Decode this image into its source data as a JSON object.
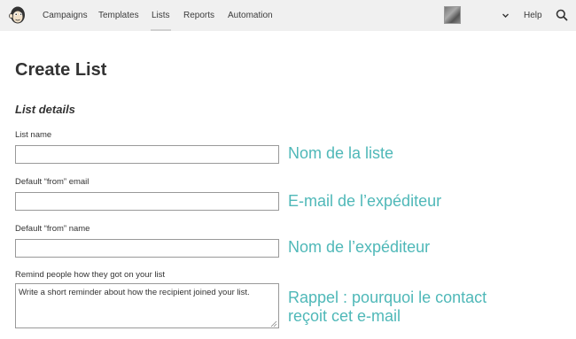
{
  "nav": {
    "items": [
      {
        "label": "Campaigns"
      },
      {
        "label": "Templates"
      },
      {
        "label": "Lists"
      },
      {
        "label": "Reports"
      },
      {
        "label": "Automation"
      }
    ],
    "help_label": "Help",
    "logo_icon": "chimp-logo-icon",
    "search_icon": "search-icon"
  },
  "page": {
    "title": "Create List",
    "section_title": "List details"
  },
  "fields": {
    "list_name": {
      "label": "List name",
      "value": ""
    },
    "from_email": {
      "label": "Default “from” email",
      "value": ""
    },
    "from_name": {
      "label": "Default “from” name",
      "value": ""
    },
    "reminder": {
      "label": "Remind people how they got on your list",
      "placeholder": "Write a short reminder about how the recipient joined your list."
    }
  },
  "annotations": {
    "list_name": "Nom de la liste",
    "from_email": "E-mail de l’expéditeur",
    "from_name": "Nom de l’expéditeur",
    "reminder_line1": "Rappel : pourquoi le contact",
    "reminder_line2": "reçoit cet e-mail"
  },
  "colors": {
    "annotation": "#4fb8b8",
    "topbar": "#f0f0f0"
  }
}
